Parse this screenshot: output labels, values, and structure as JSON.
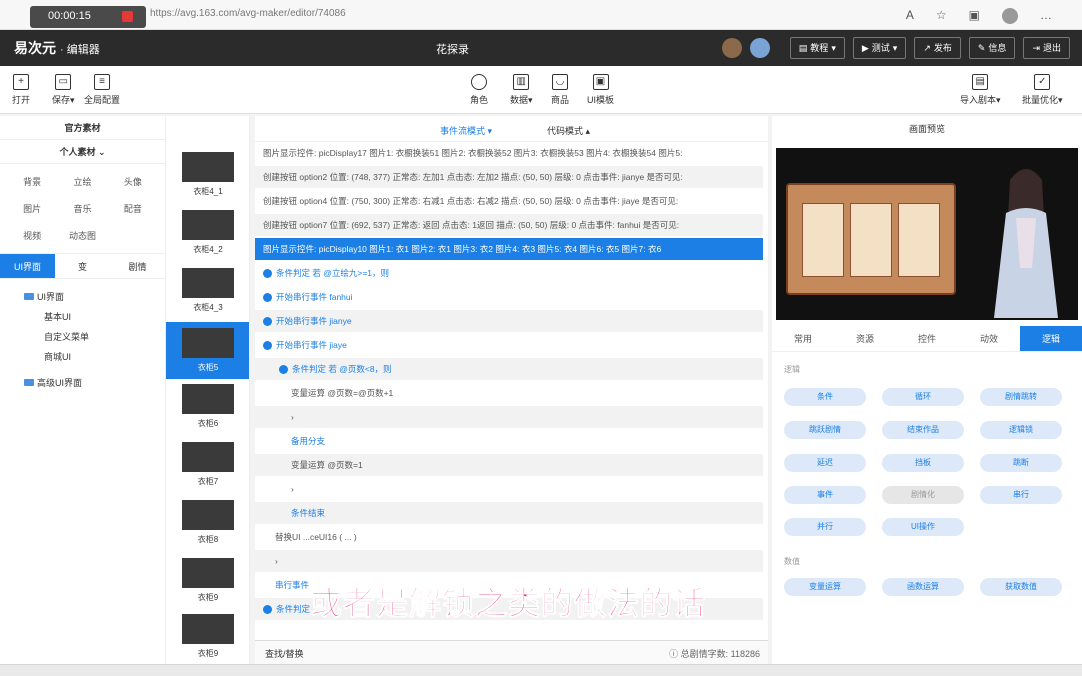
{
  "browser": {
    "rec_time": "00:00:15",
    "url": "https://avg.163.com/avg-maker/editor/74086"
  },
  "app": {
    "logo": "易次元",
    "logo_sub": "· 编辑器",
    "project_title": "花探录",
    "buttons": [
      "教程",
      "测试",
      "发布",
      "信息",
      "退出"
    ]
  },
  "toolbar": {
    "left": [
      "打开",
      "保存",
      "全局配置"
    ],
    "center": [
      "角色",
      "数据",
      "商品",
      "UI模板"
    ],
    "right": [
      "导入剧本",
      "批量优化"
    ]
  },
  "left_panel": {
    "official": "官方素材",
    "personal": "个人素材",
    "chips": [
      "背景",
      "立绘",
      "头像",
      "图片",
      "音乐",
      "配音",
      "视频",
      "动态图"
    ],
    "tabs": [
      "UI界面",
      "变",
      "剧情"
    ],
    "tree": {
      "root": "UI界面",
      "children": [
        "基本UI",
        "自定义菜单",
        "商城UI"
      ],
      "advanced": "高级UI界面"
    }
  },
  "thumbs": [
    "衣柜4_1",
    "衣柜4_2",
    "衣柜4_3",
    "衣柜5",
    "衣柜6",
    "衣柜7",
    "衣柜8",
    "衣柜9",
    "衣柜9"
  ],
  "editor": {
    "mode_event": "事件流模式",
    "mode_code": "代码模式",
    "lines": [
      "图片显示控件:  picDisplay17   图片1: 衣橱换装51   图片2: 衣橱换装52   图片3: 衣橱换装53   图片4: 衣橱换装54   图片5:",
      "创建按钮   option2   位置: (748, 377)   正常态: 左加1   点击态: 左加2   描点: (50, 50)   层级: 0   点击事件: jianye   是否可见:",
      "创建按钮   option4   位置: (750, 300)   正常态: 右减1   点击态: 右减2   描点: (50, 50)   层级: 0   点击事件: jiaye   是否可见:",
      "创建按钮   option7   位置: (692, 537)   正常态: 返回   点击态: 1返回   描点: (50, 50)   层级: 0   点击事件: fanhui   是否可见:",
      "图片显示控件:  picDisplay10   图片1: 衣1   图片2: 衣1   图片3: 衣2   图片4: 衣3   图片5: 衣4   图片6: 衣5   图片7: 衣6",
      "条件判定   若 @立绘九>=1，则",
      "开始串行事件   fanhui",
      "开始串行事件   jianye",
      "开始串行事件   jiaye",
      "条件判定   若 @页数<8，则",
      "变量运算   @页数=@页数+1",
      "›",
      "备用分支",
      "变量运算   @页数=1",
      "›",
      "条件结束",
      "替换UI   ...ceUI16   ( ... )",
      "›",
      "串行事件",
      "条件判定"
    ],
    "find": "查找/替换",
    "count_label": "总剧情字数:",
    "count_value": "118286"
  },
  "right_panel": {
    "title": "画面预览",
    "tabs": [
      "常用",
      "资源",
      "控件",
      "动效",
      "逻辑"
    ],
    "section_logic": "逻辑",
    "logic_pills": [
      "条件",
      "循环",
      "剧情跳转",
      "跳跃剧情",
      "结束作品",
      "逻辑锁",
      "延迟",
      "挡板",
      "跳断",
      "事件",
      "剧情化",
      "串行",
      "并行",
      "UI操作"
    ],
    "section_data": "数值",
    "data_pills": [
      "变量运算",
      "函数运算",
      "获取数值"
    ]
  },
  "overlay_subtitle": "或者是解锁之类的做法的话"
}
